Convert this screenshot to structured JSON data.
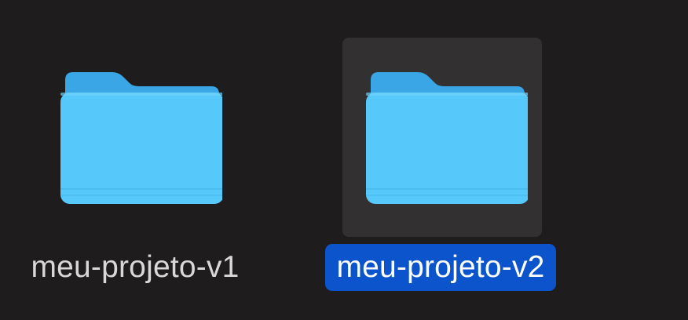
{
  "items": [
    {
      "label": "meu-projeto-v1",
      "icon": "folder-icon",
      "selected": false
    },
    {
      "label": "meu-projeto-v2",
      "icon": "folder-icon",
      "selected": true
    }
  ],
  "colors": {
    "background": "#1e1c1d",
    "selection_tile": "#323031",
    "selection_label": "#0b54cc",
    "folder_front": "#56c8f9",
    "folder_back": "#3aa6e6"
  }
}
